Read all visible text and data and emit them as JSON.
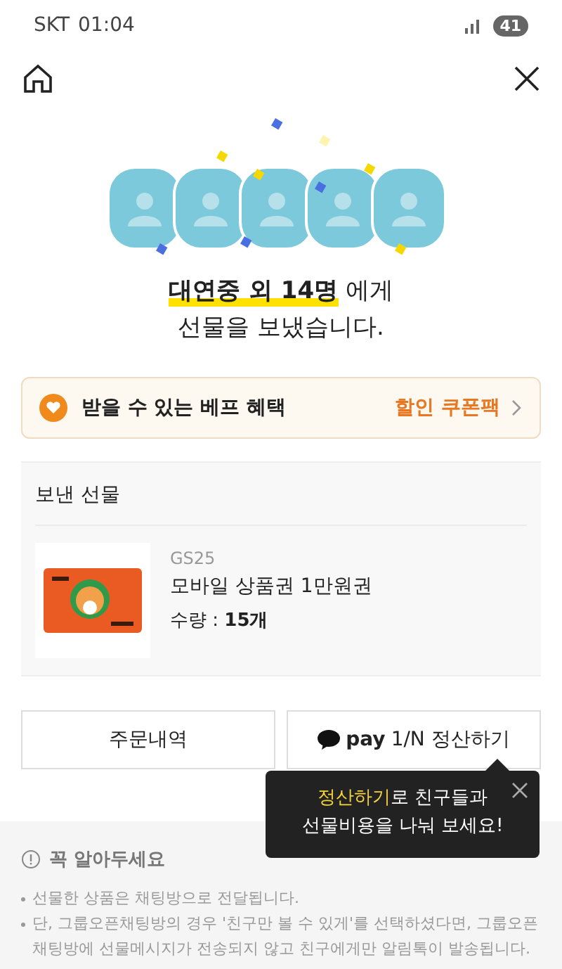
{
  "status_bar": {
    "carrier": "SKT",
    "time": "01:04",
    "battery": "41"
  },
  "recipients": [
    {
      "kind": "avatar"
    },
    {
      "kind": "avatar"
    },
    {
      "kind": "avatar"
    },
    {
      "kind": "avatar"
    },
    {
      "kind": "avatar"
    }
  ],
  "title": {
    "highlight": "대연중 외 14명",
    "rest": " 에게",
    "line2": "선물을 보냈습니다."
  },
  "benefit": {
    "label": "받을 수 있는 베프 혜택",
    "link": "할인 쿠폰팩"
  },
  "gifts": {
    "heading": "보낸 선물",
    "items": [
      {
        "brand": "GS25",
        "name": "모바일 상품권 1만원권",
        "quantity_label": "수량 : ",
        "quantity": "15개"
      }
    ]
  },
  "buttons": [
    {
      "kind": "plain",
      "label": "주문내역"
    },
    {
      "kind": "pay",
      "label": "**pay** 1/N 정산하기"
    }
  ],
  "tooltip": {
    "highlight": "정산하기",
    "rest": "로 친구들과",
    "line2": "선물비용을 나눠 보세요!"
  },
  "notice": {
    "title": "꼭 알아두세요",
    "items": [
      "선물한 상품은 채팅방으로 전달됩니다.",
      "단, 그룹오픈채팅방의 경우 '친구만 볼 수 있게'를 선택하셨다면, 그룹오픈채팅방에 선물메시지가 전송되지 않고 친구에게만 알림톡이 발송됩니다."
    ]
  }
}
